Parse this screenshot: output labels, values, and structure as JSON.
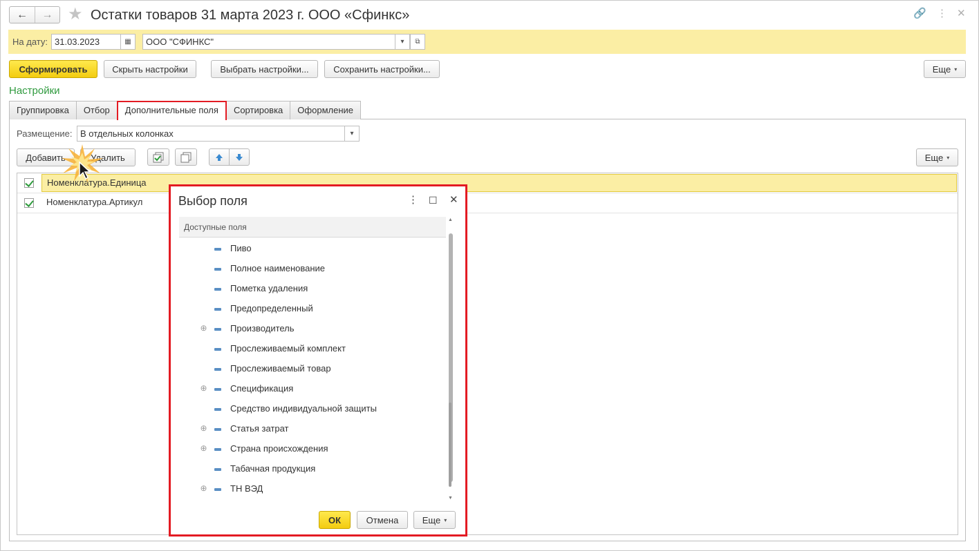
{
  "window": {
    "title": "Остатки товаров 31 марта 2023 г. ООО «Сфинкс»"
  },
  "icons": {
    "back": "←",
    "forward": "→",
    "star": "★",
    "link": "🔗",
    "more": "⋮",
    "close": "✕",
    "calendar": "▦",
    "dropdown": "▾",
    "open": "⧉",
    "maximize": "☐"
  },
  "filterbar": {
    "date_label": "На дату:",
    "date_value": "31.03.2023",
    "org_value": "ООО \"СФИНКС\""
  },
  "toolbar": {
    "generate": "Сформировать",
    "hide_settings": "Скрыть настройки",
    "choose_settings": "Выбрать настройки...",
    "save_settings": "Сохранить настройки...",
    "more": "Еще"
  },
  "settings": {
    "title": "Настройки",
    "tabs": [
      "Группировка",
      "Отбор",
      "Дополнительные поля",
      "Сортировка",
      "Оформление"
    ],
    "placement_label": "Размещение:",
    "placement_value": "В отдельных колонках",
    "add": "Добавить",
    "delete": "Удалить",
    "more": "Еще",
    "rows": [
      "Номенклатура.Единица",
      "Номенклатура.Артикул"
    ]
  },
  "dialog": {
    "title": "Выбор поля",
    "header": "Доступные поля",
    "items": [
      {
        "label": "Пиво",
        "expandable": false
      },
      {
        "label": "Полное наименование",
        "expandable": false
      },
      {
        "label": "Пометка удаления",
        "expandable": false
      },
      {
        "label": "Предопределенный",
        "expandable": false
      },
      {
        "label": "Производитель",
        "expandable": true
      },
      {
        "label": "Прослеживаемый комплект",
        "expandable": false
      },
      {
        "label": "Прослеживаемый товар",
        "expandable": false
      },
      {
        "label": "Спецификация",
        "expandable": true
      },
      {
        "label": "Средство индивидуальной защиты",
        "expandable": false
      },
      {
        "label": "Статья затрат",
        "expandable": true
      },
      {
        "label": "Страна происхождения",
        "expandable": true
      },
      {
        "label": "Табачная продукция",
        "expandable": false
      },
      {
        "label": "ТН ВЭД",
        "expandable": true
      }
    ],
    "ok": "ОК",
    "cancel": "Отмена",
    "more": "Еще"
  },
  "colors": {
    "accent_yellow": "#fbeea4",
    "primary_button": "#f3cc10",
    "highlight_red": "#e31b23",
    "section_green": "#2f9a3e"
  }
}
